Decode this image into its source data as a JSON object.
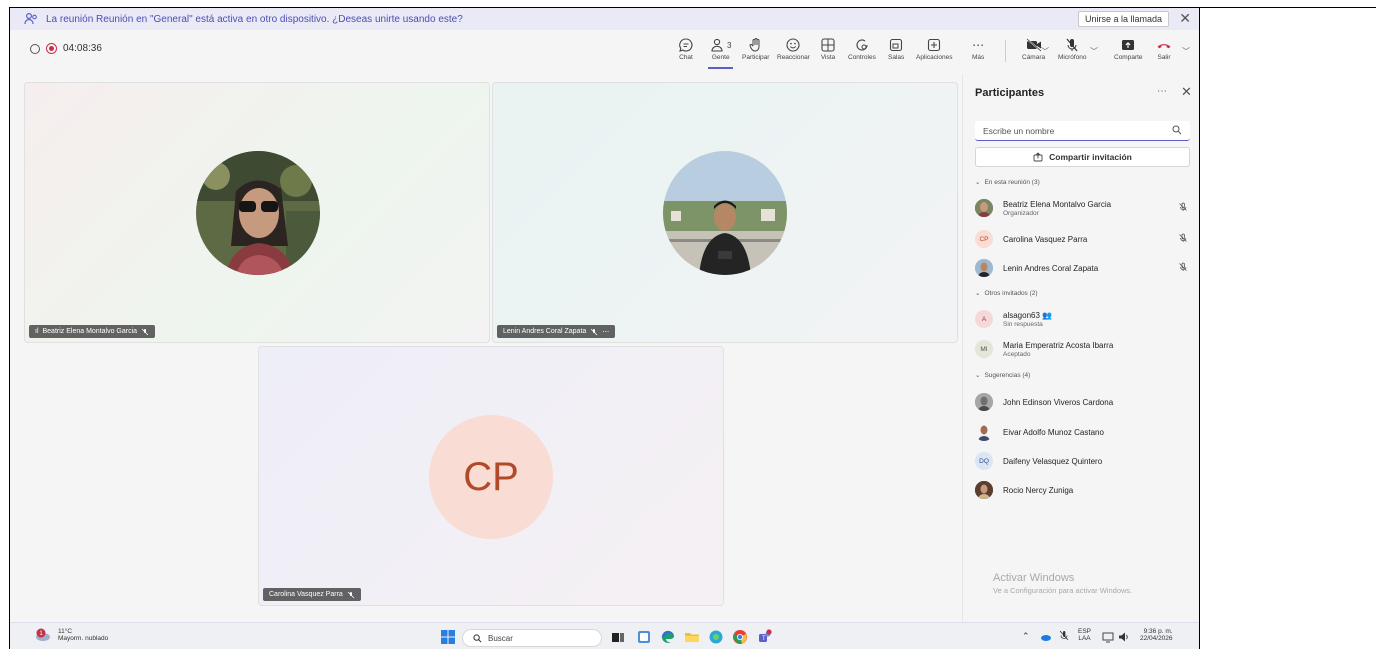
{
  "banner": {
    "message": "La reunión Reunión en \"General\" está activa en otro dispositivo. ¿Deseas unirte usando este?",
    "join_label": "Unirse a la llamada",
    "close_glyph": "✕"
  },
  "toolbar": {
    "timer": "04:08:36",
    "people_count": "3",
    "items": {
      "chat": "Chat",
      "people": "Gente",
      "raise": "Participar",
      "react": "Reaccionar",
      "view": "Vista",
      "controls": "Controles",
      "rooms": "Salas",
      "apps": "Aplicaciones",
      "more": "Más",
      "camera": "Cámara",
      "mic": "Micrófono",
      "share": "Comparte",
      "leave": "Salir"
    }
  },
  "stage": {
    "tiles": [
      {
        "name": "Beatriz Elena Montalvo Garcia"
      },
      {
        "name": "Lenin Andres Coral Zapata"
      },
      {
        "name": "Carolina Vasquez Parra",
        "initials": "CP"
      }
    ]
  },
  "panel": {
    "title": "Participantes",
    "search_placeholder": "Escribe un nombre",
    "share_label": "Compartir invitación",
    "sections": {
      "in_meeting": "En esta reunión (3)",
      "invited": "Otros invitados (2)",
      "suggestions": "Sugerencias (4)"
    },
    "in_meeting": [
      {
        "name": "Beatriz Elena Montalvo Garcia",
        "sub": "Organizador"
      },
      {
        "name": "Carolina Vasquez Parra",
        "initials": "CP"
      },
      {
        "name": "Lenin Andres Coral Zapata"
      }
    ],
    "invited": [
      {
        "name": "alsagon63",
        "sub": "Sin respuesta",
        "initials": "A"
      },
      {
        "name": "Maria Emperatriz Acosta Ibarra",
        "sub": "Aceptado",
        "initials": "MI"
      }
    ],
    "suggestions": [
      {
        "name": "John Edinson Viveros Cardona"
      },
      {
        "name": "Eivar Adolfo Munoz Castano"
      },
      {
        "name": "Daifeny Velasquez Quintero",
        "initials": "DQ"
      },
      {
        "name": "Rocio Nercy Zuniga"
      }
    ],
    "watermark_title": "Activar Windows",
    "watermark_sub": "Ve a Configuración para activar Windows."
  },
  "taskbar": {
    "temp": "11°C",
    "weather": "Mayorm. nublado",
    "weather_badge": "1",
    "search": "Buscar",
    "lang": "ESP",
    "lang_sub": "LAA",
    "time": "9:36 p. m.",
    "date": "22/04/2026"
  },
  "colors": {
    "accent": "#5b5fc7",
    "record": "#c4314b",
    "leave": "#c4314b",
    "cp_avatar_bg": "#f9dcd4",
    "cp_avatar_fg": "#b24a2a"
  }
}
